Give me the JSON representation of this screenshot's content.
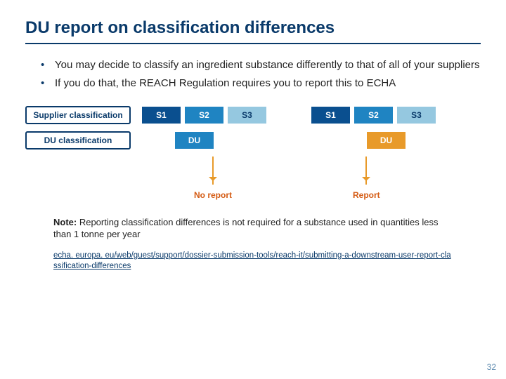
{
  "title": "DU report on classification differences",
  "bullets": [
    "You may decide to classify an ingredient substance differently to that of all of your suppliers",
    "If you do that, the REACH Regulation requires you to report this to ECHA"
  ],
  "diagram": {
    "row_labels": {
      "supplier": "Supplier classification",
      "du": "DU classification"
    },
    "supplier_boxes": [
      "S1",
      "S2",
      "S3"
    ],
    "du_box": "DU",
    "outcomes": {
      "no_report": "No report",
      "report": "Report"
    }
  },
  "note": {
    "label": "Note:",
    "text": " Reporting classification differences is not required for a substance used in quantities less than 1 tonne per year"
  },
  "link": "echa. europa. eu/web/guest/support/dossier-submission-tools/reach-it/submitting-a-downstream-user-report-classification-differences",
  "page_number": "32"
}
